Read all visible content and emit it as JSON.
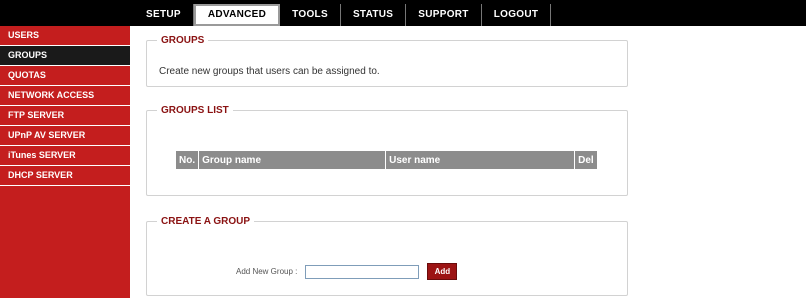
{
  "nav": {
    "tabs": [
      {
        "label": "SETUP"
      },
      {
        "label": "ADVANCED"
      },
      {
        "label": "TOOLS"
      },
      {
        "label": "STATUS"
      },
      {
        "label": "SUPPORT"
      },
      {
        "label": "LOGOUT"
      }
    ],
    "active": "ADVANCED"
  },
  "sidebar": {
    "items": [
      {
        "label": "USERS"
      },
      {
        "label": "GROUPS"
      },
      {
        "label": "QUOTAS"
      },
      {
        "label": "NETWORK ACCESS"
      },
      {
        "label": "FTP SERVER"
      },
      {
        "label": "UPnP AV SERVER"
      },
      {
        "label": "iTunes SERVER"
      },
      {
        "label": "DHCP SERVER"
      }
    ],
    "active": "GROUPS"
  },
  "groups": {
    "title": "GROUPS",
    "description": "Create new groups that users can be assigned to."
  },
  "groups_list": {
    "title": "GROUPS LIST",
    "columns": [
      "No.",
      "Group name",
      "User name",
      "Del"
    ]
  },
  "create_group": {
    "title": "CREATE A GROUP",
    "label": "Add New Group :",
    "input_value": "",
    "button_label": "Add"
  },
  "colors": {
    "sidebar": "#c41e1e",
    "sidebar_active": "#1a1a1a",
    "topbar": "#000000",
    "legend": "#8a1212",
    "table_header": "#8c8c8c",
    "button": "#9c1414"
  }
}
